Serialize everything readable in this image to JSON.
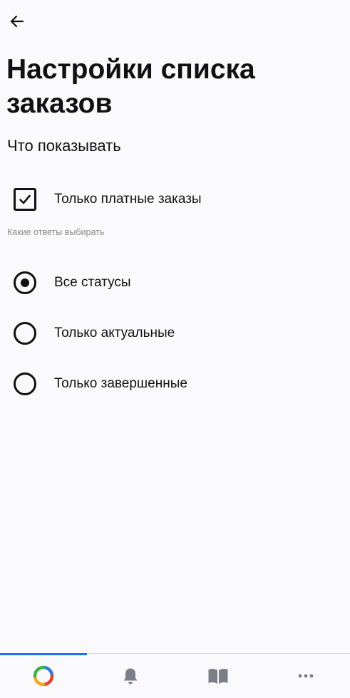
{
  "header": {
    "back_icon": "arrow-left-icon",
    "title": "Настройки списка заказов"
  },
  "section": {
    "title": "Что показывать"
  },
  "options": {
    "paid_only": {
      "label": "Только платные заказы",
      "checked": true
    }
  },
  "answers": {
    "hint": "Какие ответы выбирать",
    "items": [
      {
        "label": "Все статусы",
        "selected": true
      },
      {
        "label": "Только актуальные",
        "selected": false
      },
      {
        "label": "Только завершенные",
        "selected": false
      }
    ]
  },
  "bottom_nav": {
    "active_index": 0,
    "items": [
      {
        "icon": "app-logo-icon"
      },
      {
        "icon": "bell-icon"
      },
      {
        "icon": "book-icon"
      },
      {
        "icon": "more-dots-icon"
      }
    ]
  },
  "colors": {
    "background": "#fafafc",
    "text": "#111111",
    "hint": "#8a8a8e",
    "accent": "#1a73e8",
    "nav_icon": "#7a7e87"
  }
}
